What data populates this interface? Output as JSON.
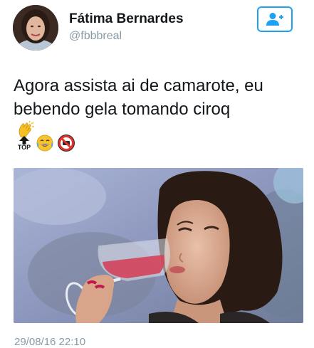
{
  "author": {
    "name": "Fátima Bernardes",
    "handle": "@fbbbreal"
  },
  "follow_button": {
    "icon": "add-user-icon",
    "color": "#1da1f2"
  },
  "tweet": {
    "lines": [
      "Agora assista ai de camarote, eu",
      "bebendo gela tomando ciroq"
    ],
    "emojis": [
      "clapping-hands",
      "top-arrow",
      "tears-of-joy-face",
      "no-entry-sign"
    ],
    "top_label": "TOP"
  },
  "media": {
    "description_icon": "photo"
  },
  "timestamp": "29/08/16 22:10"
}
